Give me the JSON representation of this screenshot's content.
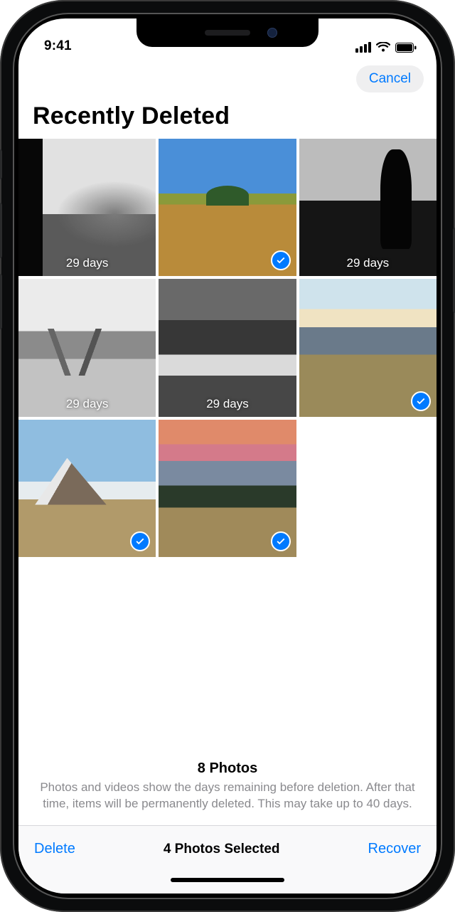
{
  "status": {
    "time": "9:41"
  },
  "nav": {
    "cancel": "Cancel"
  },
  "title": "Recently Deleted",
  "grid": {
    "items": [
      {
        "days": "29 days",
        "selected": false
      },
      {
        "days": "",
        "selected": true
      },
      {
        "days": "29 days",
        "selected": false
      },
      {
        "days": "29 days",
        "selected": false
      },
      {
        "days": "29 days",
        "selected": false
      },
      {
        "days": "",
        "selected": true
      },
      {
        "days": "",
        "selected": true
      },
      {
        "days": "",
        "selected": true
      }
    ]
  },
  "info": {
    "title": "8 Photos",
    "text": "Photos and videos show the days remaining before deletion. After that time, items will be permanently deleted. This may take up to 40 days."
  },
  "toolbar": {
    "delete": "Delete",
    "status": "4 Photos Selected",
    "recover": "Recover"
  }
}
